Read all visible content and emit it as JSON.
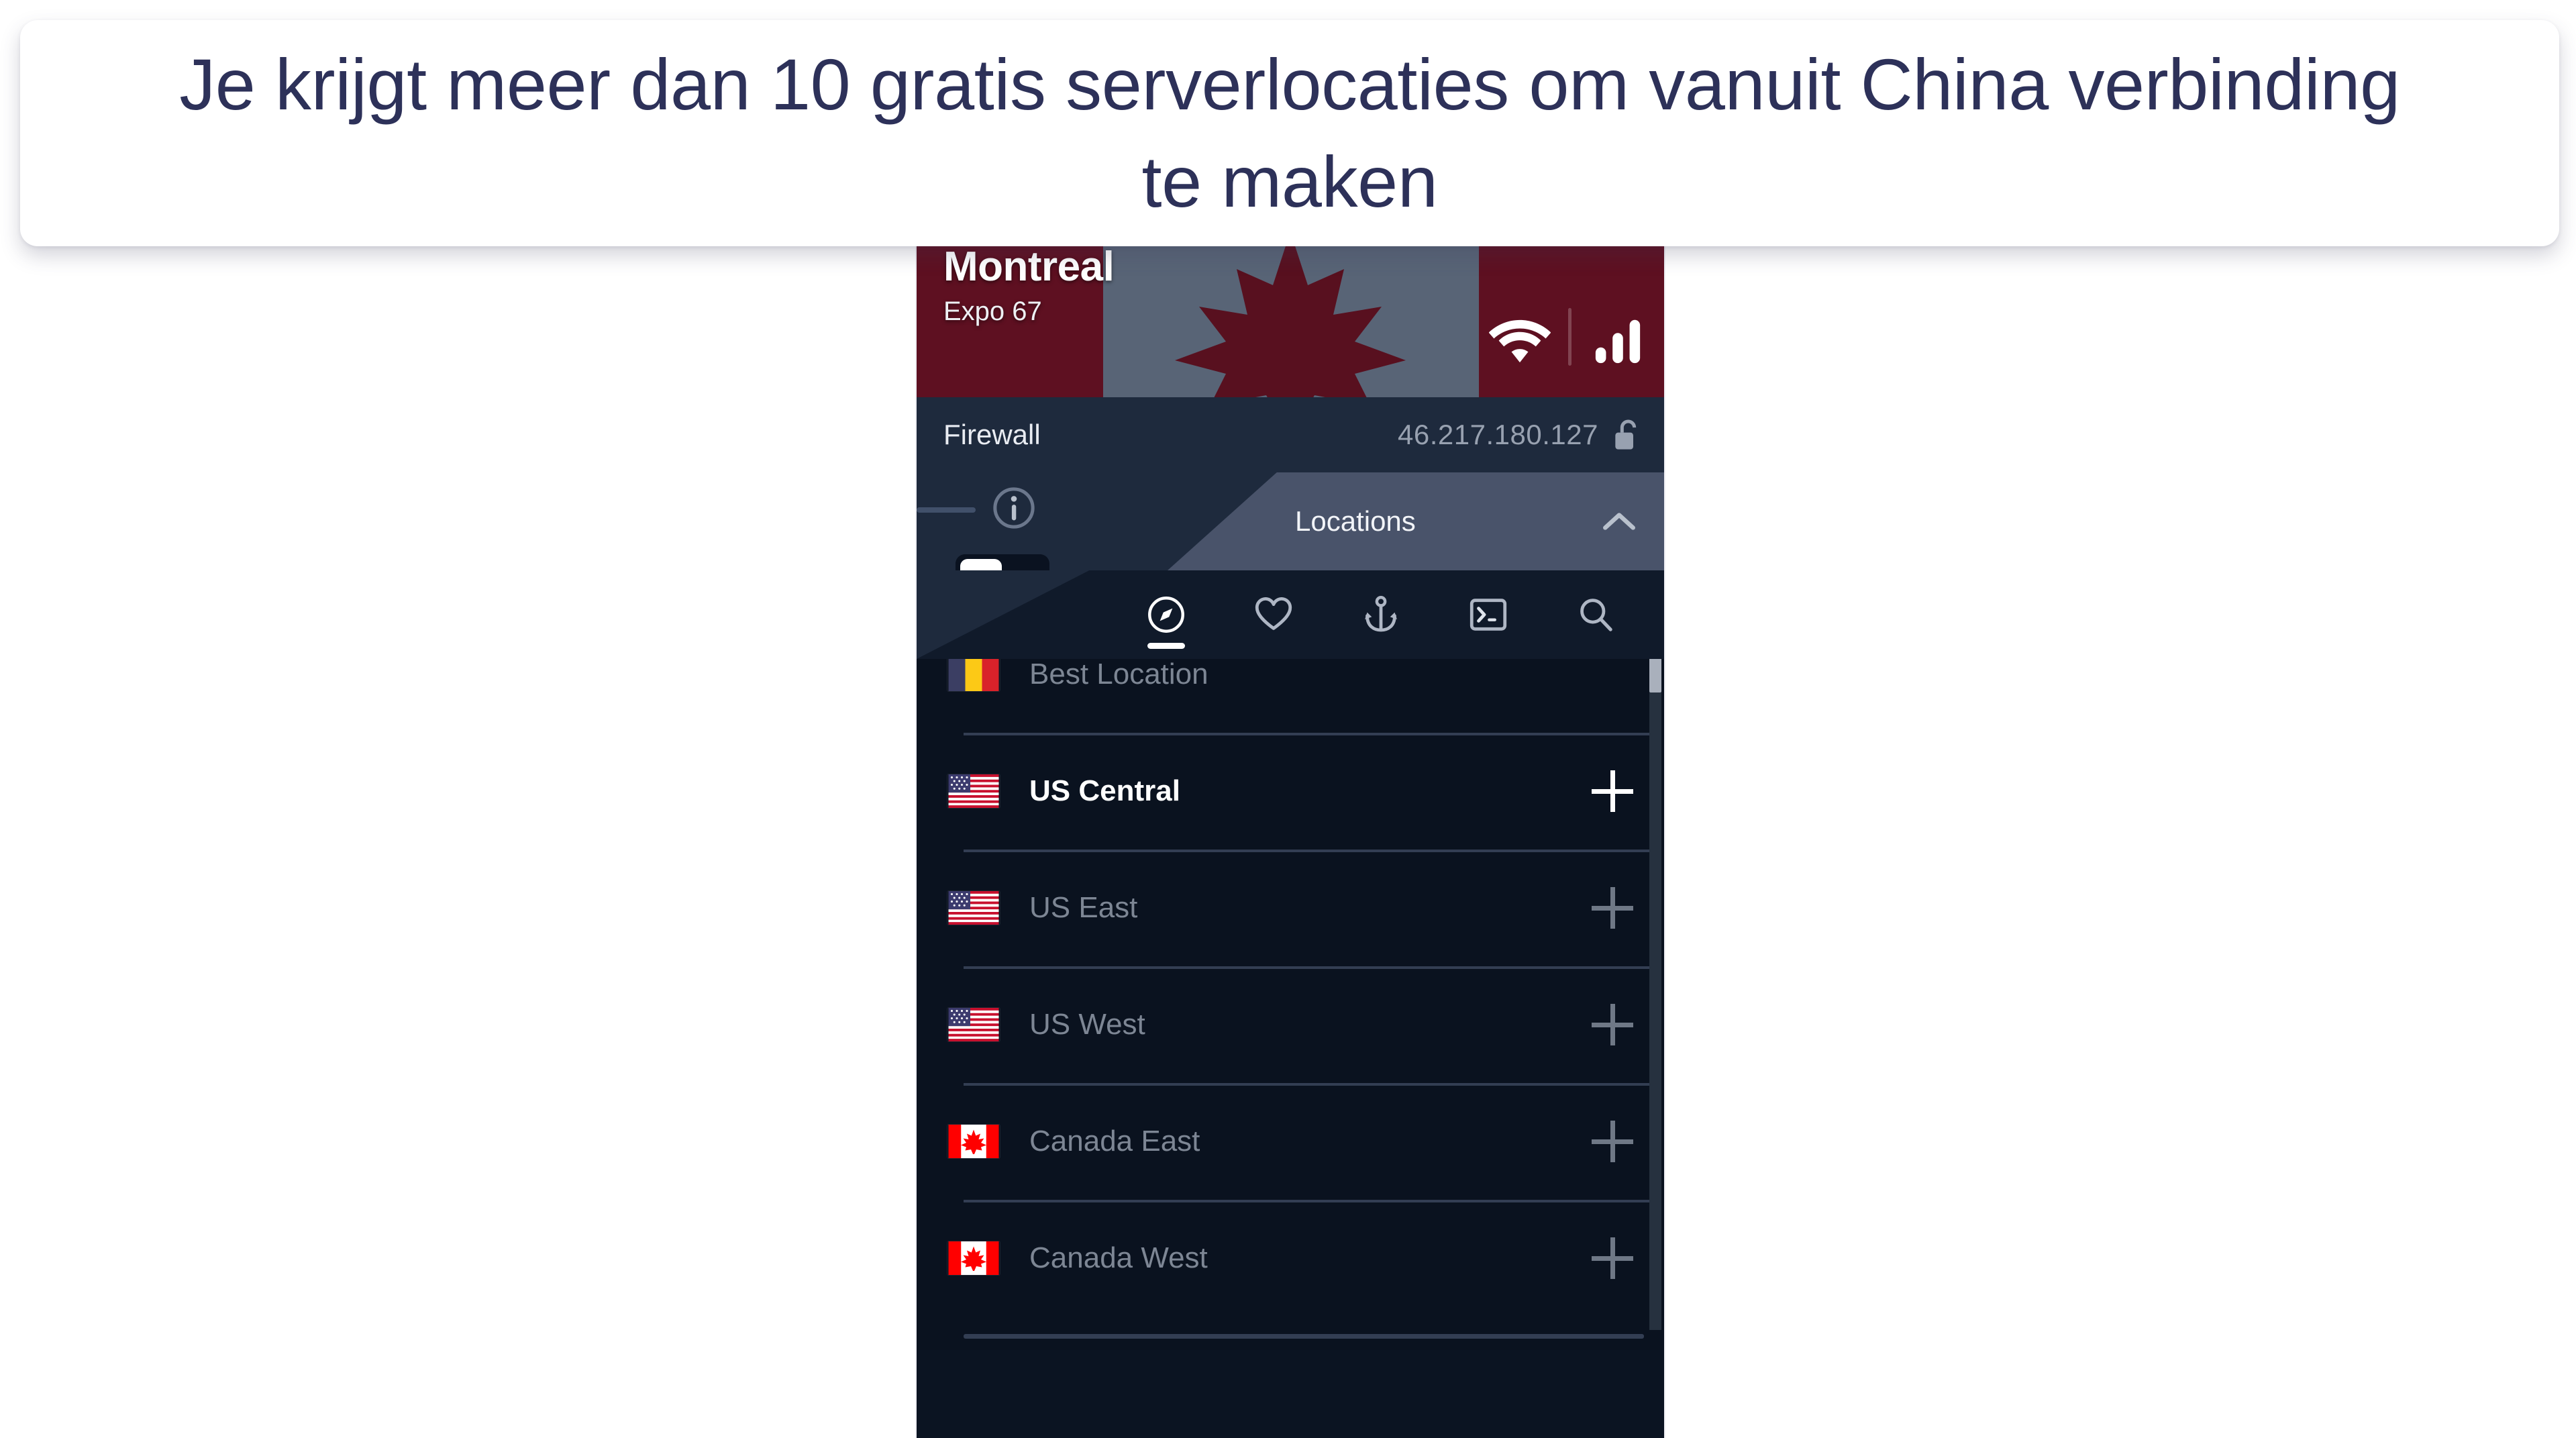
{
  "headline": {
    "text": "Je krijgt meer dan 10 gratis serverlocaties om vanuit China verbinding te maken",
    "color": "#2d3159"
  },
  "app": {
    "hero": {
      "city": "Montreal",
      "server": "Expo 67",
      "flag_country": "Canada",
      "flag_colors": {
        "red": "#631021",
        "band": "#5d6a7c"
      },
      "icons": {
        "wifi": "wifi-icon",
        "signal": "signal-bars-icon"
      }
    },
    "firewall": {
      "label": "Firewall",
      "ip_address": "46.217.180.127",
      "lock_icon": "unlock-icon",
      "info_icon": "info-icon",
      "toggle_state": "on"
    },
    "locations_panel": {
      "title": "Locations",
      "collapse_icon": "chevron-up-icon",
      "tabs": [
        {
          "name": "compass",
          "icon": "compass-icon",
          "active": true
        },
        {
          "name": "favorites",
          "icon": "heart-icon",
          "active": false
        },
        {
          "name": "static-ip",
          "icon": "anchor-icon",
          "active": false
        },
        {
          "name": "terminal",
          "icon": "terminal-icon",
          "active": false
        },
        {
          "name": "search",
          "icon": "search-icon",
          "active": false
        }
      ]
    },
    "locations": [
      {
        "label": "Best Location",
        "flag": "romania-flag",
        "active": false,
        "has_add": false
      },
      {
        "label": "US Central",
        "flag": "us-flag",
        "active": true,
        "has_add": true
      },
      {
        "label": "US East",
        "flag": "us-flag",
        "active": false,
        "has_add": true
      },
      {
        "label": "US West",
        "flag": "us-flag",
        "active": false,
        "has_add": true
      },
      {
        "label": "Canada East",
        "flag": "canada-flag",
        "active": false,
        "has_add": true
      },
      {
        "label": "Canada West",
        "flag": "canada-flag",
        "active": false,
        "has_add": true
      }
    ]
  },
  "colors": {
    "panel_bg": "#0b1422",
    "body_bg": "#1e2a3d",
    "list_bg": "#0a121f",
    "tab_panel": "#49536a",
    "accent_white": "#ffffff",
    "muted_text": "#7d8694"
  }
}
